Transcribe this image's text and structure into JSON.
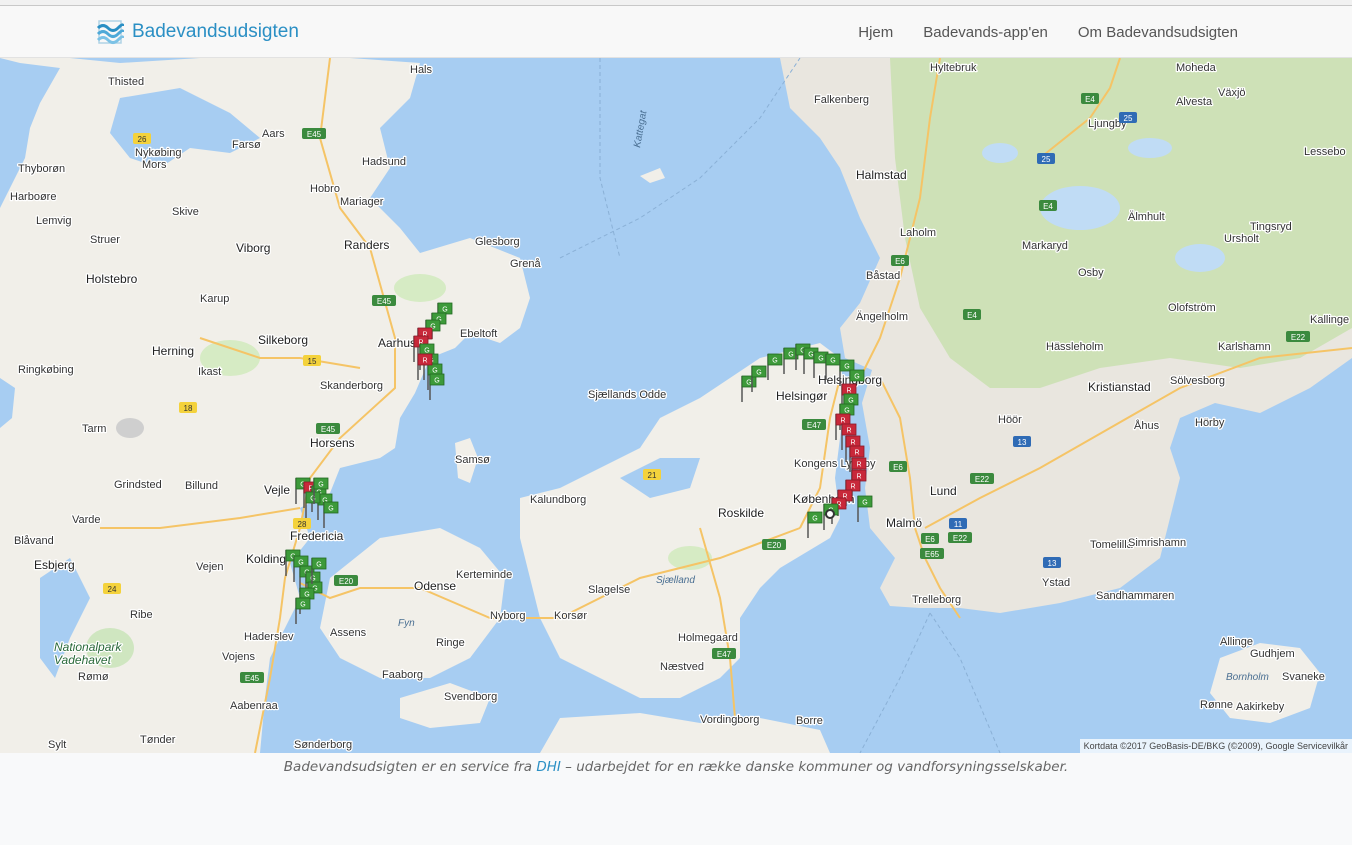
{
  "header": {
    "brand": "Badevandsudsigten",
    "nav": [
      "Hjem",
      "Badevands-app'en",
      "Om Badevandsudsigten"
    ]
  },
  "map": {
    "attribution": "Kortdata ©2017 GeoBasis-DE/BKG (©2009), Google   Servicevilkår",
    "places": [
      "Thisted",
      "Hals",
      "Aars",
      "Farsø",
      "Hadsund",
      "Nykøbing",
      "Mors",
      "Thyborøn",
      "Harboøre",
      "Hobro",
      "Mariager",
      "Skive",
      "Lemvig",
      "Struer",
      "Viborg",
      "Randers",
      "Glesborg",
      "Grenå",
      "Holstebro",
      "Karup",
      "Ebeltoft",
      "Herning",
      "Silkeborg",
      "Aarhus",
      "Ringkøbing",
      "Ikast",
      "Skanderborg",
      "Tarm",
      "Horsens",
      "Samsø",
      "Grindsted",
      "Billund",
      "Vejle",
      "Varde",
      "Fredericia",
      "Blåvand",
      "Esbjerg",
      "Vejen",
      "Kolding",
      "Ribe",
      "Haderslev",
      "Vojens",
      "Rømø",
      "Aabenraa",
      "Tønder",
      "Sønderborg",
      "Sylt",
      "Odense",
      "Kerteminde",
      "Nyborg",
      "Fyn",
      "Assens",
      "Ringe",
      "Faaborg",
      "Svendborg",
      "Kalundborg",
      "Sjællands Odde",
      "Roskilde",
      "Slagelse",
      "Sjælland",
      "Korsør",
      "Holmegaard",
      "Næstved",
      "Vordingborg",
      "Borre",
      "Helsingør",
      "Kongens Lyngby",
      "København",
      "Helsingborg",
      "Malmö",
      "Lund",
      "Trelleborg",
      "Ystad",
      "Tomelilla",
      "Simrishamn",
      "Sandhammaren",
      "Falkenberg",
      "Halmstad",
      "Laholm",
      "Båstad",
      "Ängelholm",
      "Ljungby",
      "Hässleholm",
      "Kristianstad",
      "Sölvesborg",
      "Karlshamn",
      "Växjö",
      "Alvesta",
      "Moheda",
      "Hyltebruk",
      "Lessebo",
      "Älmhult",
      "Markaryd",
      "Osby",
      "Ursholt",
      "Tingsryd",
      "Olofström",
      "Kallinge",
      "Hörby",
      "Åhus",
      "Höör",
      "Allinge",
      "Gudhjem",
      "Svaneke",
      "Bornholm",
      "Rønne",
      "Aakirkeby",
      "Kattegat"
    ],
    "park_label": "Nationalpark\nVadehavet",
    "route_shields": [
      "26",
      "E45",
      "E45",
      "15",
      "18",
      "E45",
      "28",
      "24",
      "E45",
      "E20",
      "21",
      "E47",
      "E20",
      "E47",
      "E4",
      "25",
      "25",
      "E4",
      "E6",
      "E4",
      "E22",
      "E6",
      "E22",
      "13",
      "E6",
      "11",
      "E65",
      "13",
      "E22"
    ],
    "flags": {
      "green_label": "G",
      "red_label": "R"
    }
  },
  "footer": {
    "pre": "Badevandsudsigten er en service fra ",
    "link": "DHI",
    "post": " – udarbejdet for en række danske kommuner og vandforsyningsselskaber."
  }
}
